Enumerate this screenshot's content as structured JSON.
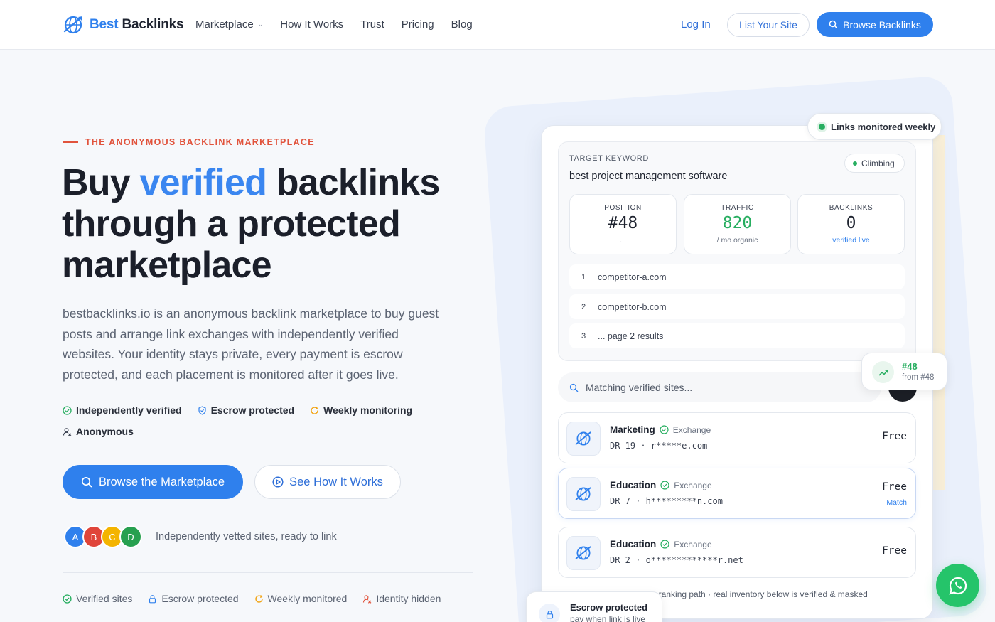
{
  "brand": {
    "name_accent": "Best",
    "name_rest": "Backlinks",
    "accent_color": "#2f80ed"
  },
  "nav": {
    "items": [
      {
        "label": "Marketplace",
        "has_dropdown": true
      },
      {
        "label": "How It Works"
      },
      {
        "label": "Trust"
      },
      {
        "label": "Pricing"
      },
      {
        "label": "Blog"
      }
    ],
    "login": "Log In",
    "list_site": "List Your Site",
    "browse": "Browse Backlinks"
  },
  "hero": {
    "eyebrow": "THE ANONYMOUS BACKLINK MARKETPLACE",
    "title_a": "Buy ",
    "title_highlight": "verified",
    "title_b": " backlinks through a protected marketplace",
    "description": "bestbacklinks.io is an anonymous backlink marketplace to buy guest posts and arrange link exchanges with independently verified websites. Your identity stays private, every payment is escrow protected, and each placement is monitored after it goes live.",
    "badges": [
      {
        "label": "Independently verified",
        "icon": "check-circle-icon"
      },
      {
        "label": "Escrow protected",
        "icon": "shield-check-icon"
      },
      {
        "label": "Weekly monitoring",
        "icon": "refresh-icon"
      },
      {
        "label": "Anonymous",
        "icon": "user-hidden-icon"
      }
    ],
    "cta_primary": "Browse the Marketplace",
    "cta_secondary": "See How It Works",
    "avatars": [
      "A",
      "B",
      "C",
      "D"
    ],
    "avatar_colors": [
      "#2f80ed",
      "#e0453a",
      "#f4b400",
      "#27a04f"
    ],
    "proof_text": "Independently vetted sites, ready to link",
    "footer": [
      {
        "label": "Verified sites",
        "icon": "check-circle-icon"
      },
      {
        "label": "Escrow protected",
        "icon": "lock-icon"
      },
      {
        "label": "Weekly monitored",
        "icon": "refresh-icon"
      },
      {
        "label": "Identity hidden",
        "icon": "user-hidden-icon"
      }
    ]
  },
  "preview": {
    "monitor_pill": "Links monitored weekly",
    "keyword_label": "TARGET KEYWORD",
    "keyword": "best project management software",
    "trend": "Climbing",
    "stats": [
      {
        "label": "POSITION",
        "value": "#48",
        "sub": "..."
      },
      {
        "label": "TRAFFIC",
        "value": "820",
        "sub": "/ mo organic"
      },
      {
        "label": "BACKLINKS",
        "value": "0",
        "sub": "verified live"
      }
    ],
    "rankings": [
      {
        "num": "1",
        "text": "competitor-a.com"
      },
      {
        "num": "2",
        "text": "competitor-b.com"
      },
      {
        "num": "3",
        "text": "... page 2 results"
      }
    ],
    "search_placeholder": "Matching verified sites...",
    "rank_change": {
      "main": "#48",
      "sub": "from #48"
    },
    "sites": [
      {
        "category": "Marketing",
        "type": "Exchange",
        "meta": "DR 19 · r*****e.com",
        "price": "Free",
        "match": ""
      },
      {
        "category": "Education",
        "type": "Exchange",
        "meta": "DR 7 · h*********n.com",
        "price": "Free",
        "match": "Match"
      },
      {
        "category": "Education",
        "type": "Exchange",
        "meta": "DR 2 · o*************r.net",
        "price": "Free",
        "match": ""
      }
    ],
    "note": "...illustrative ranking path · real inventory below is verified & masked",
    "escrow": {
      "title": "Escrow protected",
      "sub": "pay when link is live"
    }
  }
}
